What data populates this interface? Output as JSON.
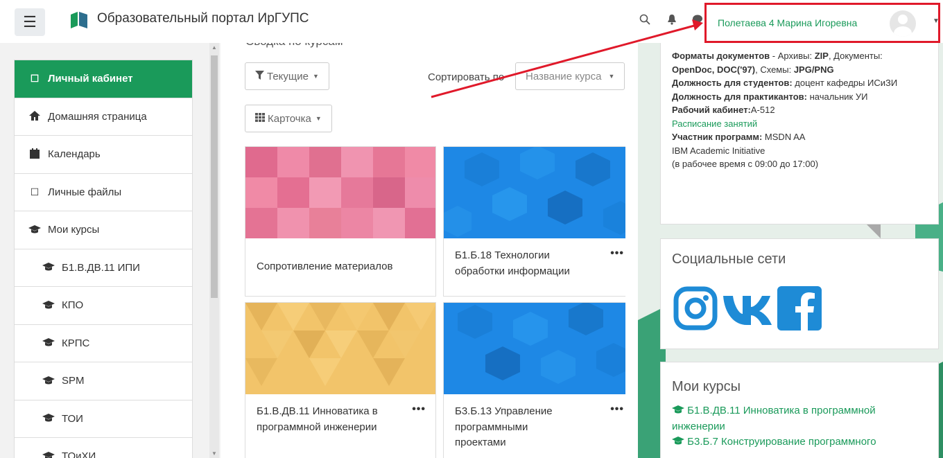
{
  "header": {
    "site_title": "Образовательный портал ИрГУПС",
    "user_name": "Полетаева 4 Марина Игоревна",
    "icons": [
      "menu-icon",
      "logo",
      "search-icon",
      "bell-icon",
      "chat-icon",
      "avatar",
      "caret-down-icon"
    ]
  },
  "sidebar": {
    "items": [
      {
        "label": "Личный кабинет",
        "icon": "square-icon"
      },
      {
        "label": "Домашняя страница",
        "icon": "home-icon"
      },
      {
        "label": "Календарь",
        "icon": "calendar-icon"
      },
      {
        "label": "Личные файлы",
        "icon": "file-icon"
      },
      {
        "label": "Мои курсы",
        "icon": "graduation-cap-icon"
      },
      {
        "label": "Б1.В.ДВ.11 ИПИ",
        "icon": "graduation-cap-icon"
      },
      {
        "label": "КПО",
        "icon": "graduation-cap-icon"
      },
      {
        "label": "КРПС",
        "icon": "graduation-cap-icon"
      },
      {
        "label": "SPM",
        "icon": "graduation-cap-icon"
      },
      {
        "label": "ТОИ",
        "icon": "graduation-cap-icon"
      },
      {
        "label": "ТОиХИ",
        "icon": "graduation-cap-icon"
      }
    ]
  },
  "main": {
    "title": "Сводка по курсам",
    "filter_label": "Текущие",
    "sort_label": "Сортировать по",
    "sort_value": "Название курса",
    "view_label": "Карточка",
    "courses": [
      {
        "name": "Сопротивление материалов",
        "color": "#e8789a"
      },
      {
        "name": "Б1.Б.18 Технологии обработки информации",
        "color": "#1e88e5"
      },
      {
        "name": "Б1.В.ДВ.11 Инноватика в программной инженерии",
        "color": "#f2c46a"
      },
      {
        "name": "Б3.Б.13 Управление программными проектами",
        "color": "#1e88e5"
      }
    ]
  },
  "info": {
    "lines": [
      {
        "bold": "Форматы документов",
        "text": " - Архивы: "
      },
      {
        "bold": "ZIP",
        "text": ", Документы:"
      },
      {
        "bold": "OpenDoc, DOC('97)",
        "text": ", Схемы: "
      },
      {
        "bold": "JPG/PNG",
        "text": ""
      },
      {
        "bold": "Должность для студентов:",
        "text": " доцент кафедры ИСиЗИ"
      },
      {
        "bold": "Должность для практикантов:",
        "text": " начальник УИ"
      },
      {
        "bold": "Рабочий кабинет:",
        "text": "А-512"
      }
    ],
    "schedule_link": "Расписание занятий",
    "member_bold": "Участник программ:",
    "member_text": " MSDN AA",
    "ibm": "IBM Academic Initiative",
    "hours": "(в рабочее время с 09:00 до 17:00)"
  },
  "social": {
    "title": "Социальные сети",
    "icons": [
      "instagram-icon",
      "vk-icon",
      "facebook-icon"
    ]
  },
  "my_courses": {
    "title": "Мои курсы",
    "items": [
      "Б1.В.ДВ.11 Инноватика в программной инженерии",
      "Б3.Б.7 Конструирование программного"
    ]
  },
  "colors": {
    "accent": "#1a9a5a",
    "highlight": "#e0192a"
  }
}
